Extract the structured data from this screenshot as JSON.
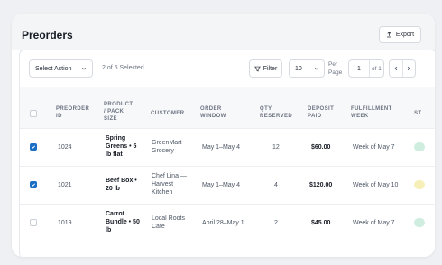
{
  "header": {
    "title": "Preorders",
    "export_label": "Export"
  },
  "toolbar": {
    "select_action": "Select Action",
    "selected_count": "2 of 6 Selected",
    "filter_label": "Filter",
    "per_page_value": "10",
    "per_page_label": "Per Page",
    "page_number": "1",
    "page_of": "of 1"
  },
  "table": {
    "columns": [
      "PREORDER ID",
      "PRODUCT / PACK SIZE",
      "CUSTOMER",
      "ORDER WINDOW",
      "QTY RESERVED",
      "DEPOSIT PAID",
      "FULFILLMENT WEEK",
      "ST"
    ],
    "rows": [
      {
        "checked": true,
        "id": "1024",
        "product": "Spring Greens • 5 lb flat",
        "customer": "GreenMart Grocery",
        "window": "May 1–May 4",
        "qty": "12",
        "deposit": "$60.00",
        "week": "Week of May 7",
        "status_color": "#cfeee0"
      },
      {
        "checked": true,
        "id": "1021",
        "product": "Beef Box • 20 lb",
        "customer": "Chef Lina — Harvest Kitchen",
        "window": "May 1–May 4",
        "qty": "4",
        "deposit": "$120.00",
        "week": "Week of May 10",
        "status_color": "#f6f0b8"
      },
      {
        "checked": false,
        "id": "1019",
        "product": "Carrot Bundle • 50 lb",
        "customer": "Local Roots Cafe",
        "window": "April 28–May 1",
        "qty": "2",
        "deposit": "$45.00",
        "week": "Week of May 7",
        "status_color": "#cfeee0"
      }
    ]
  },
  "colors": {
    "accent": "#1b6fc4"
  },
  "icons": [
    "upload-icon",
    "chevron-down-icon",
    "filter-icon",
    "chevron-left-icon",
    "chevron-right-icon",
    "checkmark-icon"
  ]
}
